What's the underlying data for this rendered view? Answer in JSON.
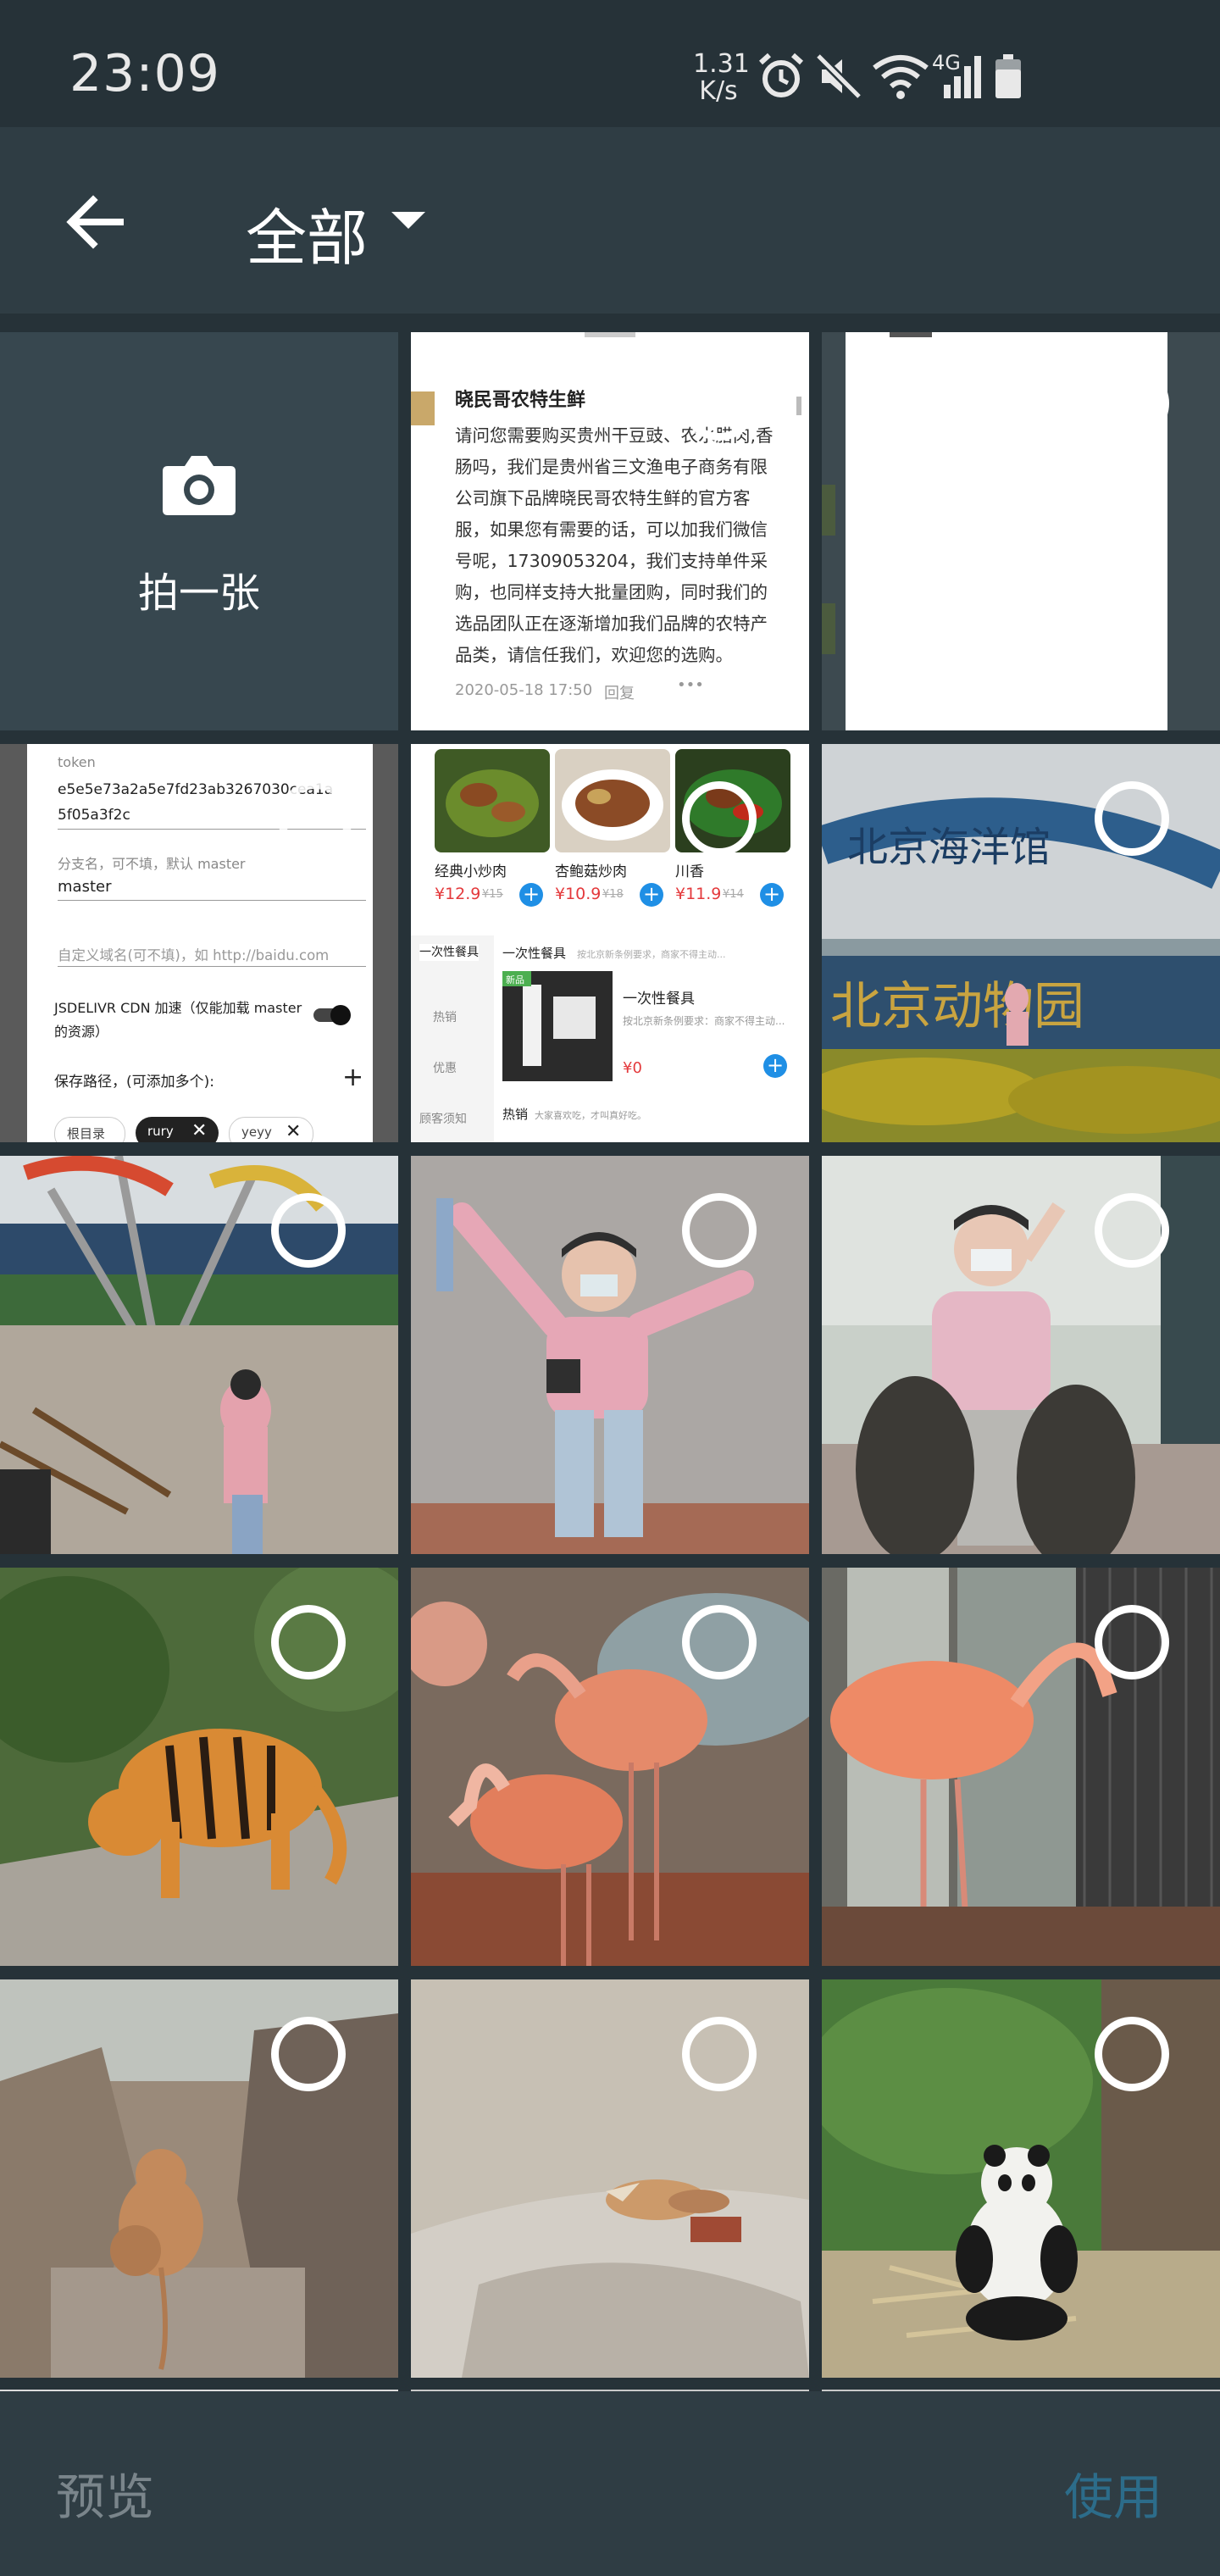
{
  "status_bar": {
    "time": "23:09",
    "net_speed_value": "1.31",
    "net_speed_unit": "K/s",
    "signal_label": "4G",
    "icons": [
      "alarm-icon",
      "mute-icon",
      "wifi-icon",
      "signal-icon",
      "battery-icon"
    ]
  },
  "header": {
    "title": "全部",
    "back_icon": "arrow-left-icon",
    "dropdown_icon": "caret-down-icon"
  },
  "camera_tile": {
    "label": "拍一张",
    "icon": "camera-icon"
  },
  "tiles": {
    "message": {
      "shop": "晓民哥农特生鲜",
      "lines": [
        "请问您需要购买贵州干豆豉、农水腊肉,香",
        "肠吗，我们是贵州省三文渔电子商务有限",
        "公司旗下品牌晓民哥农特生鲜的官方客",
        "服，如果您有需要的话，可以加我们微信",
        "号呢，17309053204，我们支持单件采",
        "购，也同样支持大批量团购，同时我们的",
        "选品团队正在逐渐增加我们品牌的农特产",
        "品类，请信任我们，欢迎您的选购。"
      ],
      "date": "2020-05-18 17:50",
      "reply": "回复",
      "more": "•••"
    },
    "settings": {
      "token_label": "token",
      "token_value_1": "e5e5e73a2a5e7fd23ab3267030cea1a",
      "token_value_2": "5f05a3f2c",
      "branch_label": "分支名，可不填，默认 master",
      "branch_value": "master",
      "domain_placeholder": "自定义域名(可不填)，如 http://baidu.com",
      "cdn_label_1": "JSDELIVR CDN 加速（仅能加载 master",
      "cdn_label_2": "的资源）",
      "path_label": "保存路径，(可添加多个):",
      "add": "+",
      "chips": [
        "根目录",
        "rury",
        "yeyy"
      ]
    },
    "menu": {
      "dishes": [
        {
          "name": "经典小炒肉",
          "price": "¥12.9",
          "old": "¥15"
        },
        {
          "name": "杏鲍菇炒肉",
          "price": "¥10.9",
          "old": "¥18"
        },
        {
          "name": "川香",
          "price": "¥11.9",
          "old": "¥14"
        }
      ],
      "sidebar": [
        "一次性餐具",
        "热销",
        "优惠",
        "顾客须知"
      ],
      "section_title": "一次性餐具",
      "section_note": "按北京新条例要求，商家不得主动...",
      "item_name": "一次性餐具",
      "item_desc": "按北京新条例要求：商家不得主动...",
      "item_price": "¥0",
      "item_tag": "新品",
      "hot_label": "热销",
      "hot_note": "大家喜欢吃，才叫真好吃。"
    },
    "sign": {
      "arch_text": "北京海洋馆",
      "stone_text": "北京动物园"
    }
  },
  "bottom_bar": {
    "preview_label": "预览",
    "use_label": "使用"
  },
  "colors": {
    "background": "#263238",
    "header": "#2f3d44",
    "camera_tile": "#37474f",
    "use_accent": "#2c6c8a",
    "preview_disabled": "#7a858b"
  }
}
